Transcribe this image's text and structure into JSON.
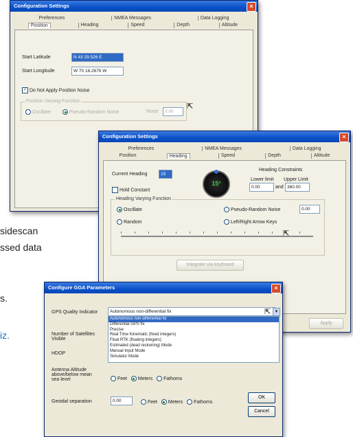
{
  "background": {
    "line1": "sidescan",
    "line2": "ssed data",
    "line3": "s.",
    "link": "iz."
  },
  "win1": {
    "title": "Configuration Settings",
    "tabs_top": [
      "Preferences",
      "NMEA Messages",
      "Data Logging"
    ],
    "tabs_bottom": [
      "Position",
      "Heading",
      "Speed",
      "Depth",
      "Altitude"
    ],
    "start_lat_label": "Start Latitude",
    "start_lat_value": "N 43 29.526 E",
    "start_lon_label": "Start Longitude",
    "start_lon_value": "W 70 18.2676 W",
    "smooth_label": "Do Not Apply Position Noise",
    "group_title": "Position Varying Function",
    "opt_sine": "Oscillate",
    "opt_random": "Pseudo-Random Noise",
    "noise_label": "Noise",
    "noise_value": "0.00"
  },
  "win2": {
    "title": "Configuration Settings",
    "tabs_top": [
      "Preferences",
      "NMEA Messages",
      "Data Logging"
    ],
    "tabs_bottom": [
      "Position",
      "Heading",
      "Speed",
      "Depth",
      "Altitude"
    ],
    "current_heading_label": "Current Heading",
    "current_heading_value": "15",
    "gauge_value": "15°",
    "constraints_title": "Heading Constraints",
    "lower_label": "Lower limit",
    "upper_label": "Upper Limit",
    "lower_value": "0.00",
    "upper_value": "360.00",
    "and_label": "and",
    "hold_constant": "Hold Constant",
    "group_title": "Heading Varying Function",
    "opt_oscillate": "Oscillate",
    "opt_random": "Pseudo-Random Noise",
    "noise_value": "0.00",
    "opt_random_walk": "Random",
    "opt_keys": "Left/Right Arrow Keys",
    "button_disabled": "Integrate via keyboard",
    "apply": "Apply"
  },
  "win3": {
    "title": "Configure GGA Parameters",
    "quality_label": "GPS Quality Indicator",
    "quality_value": "Autonomous non-differential fix",
    "options": [
      "Autonomous non-differential fix",
      "Differential GPS fix",
      "Precise",
      "Real Time Kinematic (fixed integers)",
      "Float RTK (floating integers)",
      "Estimated (dead reckoning) Mode",
      "Manual Input Mode",
      "Simulator Mode"
    ],
    "satellites_label": "Number of Satellites Visible",
    "hdop_label": "HDOP",
    "altitude_label": "Antenna Altitude above/below mean sea level",
    "unit_feet": "Feet",
    "unit_meters": "Meters",
    "unit_fathoms": "Fathoms",
    "geoidal_label": "Geoidal separation",
    "geoidal_value": "0.00",
    "ok": "OK",
    "cancel": "Cancel"
  },
  "colors": {
    "titlebar": "#0a50c8",
    "close": "#d84a2b",
    "selection": "#316ac5",
    "link": "#1f6fb5",
    "gauge_needle": "#2ea02e"
  }
}
